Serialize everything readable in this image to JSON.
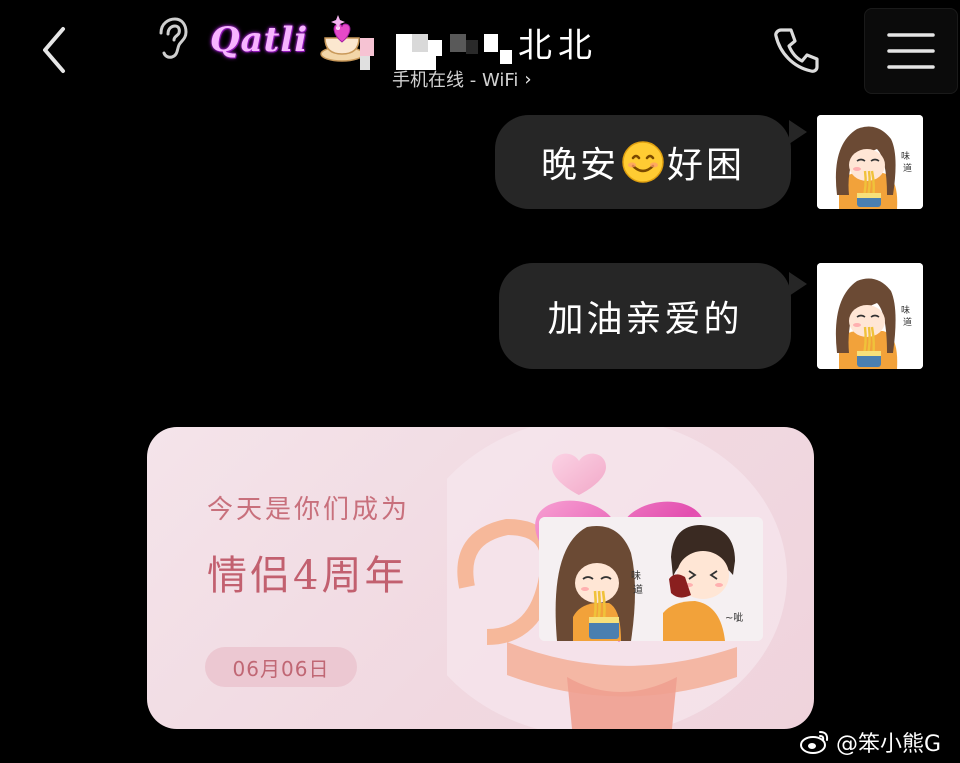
{
  "header": {
    "contact_name": "北北",
    "status": "手机在线 - WiFi",
    "status_chevron": "›",
    "logo_text": "Qatli",
    "icons": {
      "back": "back-arrow-icon",
      "ear": "ear-icon",
      "phone": "phone-icon",
      "menu": "hamburger-menu-icon"
    }
  },
  "messages": [
    {
      "sender": "me",
      "text_before": "晚安",
      "emoji": "smiling-face-icon",
      "text_after": "好困"
    },
    {
      "sender": "me",
      "text": "加油亲爱的"
    }
  ],
  "anniversary_card": {
    "line1": "今天是你们成为",
    "line2": "情侣4周年",
    "date": "06月06日"
  },
  "watermark": {
    "text": "@笨小熊G",
    "icon": "weibo-icon"
  },
  "colors": {
    "background": "#000000",
    "bubble": "#262626",
    "card_text": "#c2606f",
    "card_bg": "#f3e0e7"
  }
}
